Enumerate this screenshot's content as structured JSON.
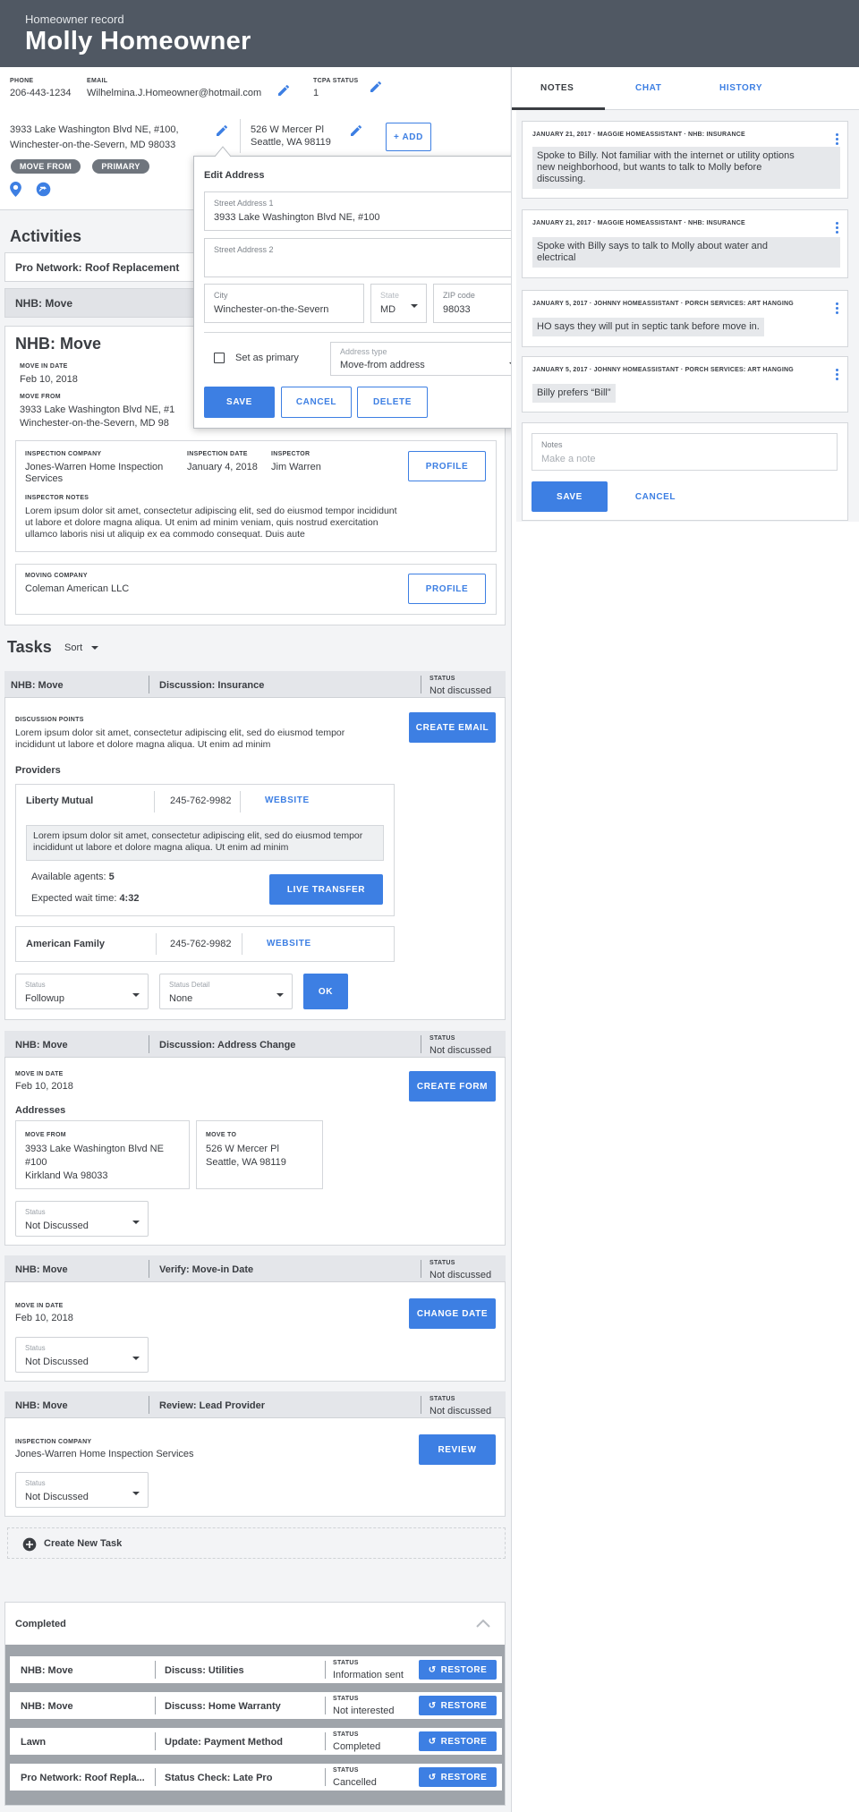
{
  "header": {
    "subtitle": "Homeowner record",
    "name": "Molly Homeowner"
  },
  "contact": {
    "phone_label": "PHONE",
    "phone": "206-443-1234",
    "email_label": "EMAIL",
    "email": "Wilhelmina.J.Homeowner@hotmail.com",
    "tcpa_label": "TCPA STATUS",
    "tcpa": "1"
  },
  "addresses": {
    "from_line1": "3933 Lake Washington Blvd NE, #100,",
    "from_line2": "Winchester-on-the-Severn, MD 98033",
    "to_line1": "526 W Mercer Pl",
    "to_line2": "Seattle, WA 98119",
    "add_label": "+ ADD",
    "badge_move_from": "MOVE FROM",
    "badge_primary": "PRIMARY"
  },
  "activities": {
    "heading": "Activities",
    "item1": "Pro Network: Roof Replacement",
    "item2": "NHB: Move",
    "detail_title": "NHB: Move",
    "move_in_label": "MOVE IN DATE",
    "move_in": "Feb 10, 2018",
    "move_from_label": "MOVE FROM",
    "move_from_1": "3933 Lake Washington Blvd NE, #1",
    "move_from_2": "Winchester-on-the-Severn, MD 98",
    "insp_company_label": "INSPECTION COMPANY",
    "insp_company": "Jones-Warren Home Inspection Services",
    "insp_date_label": "INSPECTION DATE",
    "insp_date": "January 4, 2018",
    "inspector_label": "INSPECTOR",
    "inspector": "Jim Warren",
    "profile": "PROFILE",
    "insp_notes_label": "INSPECTOR NOTES",
    "insp_notes": "Lorem ipsum dolor sit amet, consectetur adipiscing elit, sed do eiusmod tempor incididunt ut labore et dolore magna aliqua. Ut enim ad minim veniam, quis nostrud exercitation ullamco laboris nisi ut aliquip ex ea commodo consequat. Duis aute",
    "moving_company_label": "MOVING COMPANY",
    "moving_company": "Coleman American LLC"
  },
  "edit_address": {
    "title": "Edit Address",
    "street1_label": "Street Address 1",
    "street1": "3933 Lake Washington Blvd NE, #100",
    "street2_label": "Street Address 2",
    "city_label": "City",
    "city": "Winchester-on-the-Severn",
    "state_label": "State",
    "state": "MD",
    "zip_label": "ZIP code",
    "zip": "98033",
    "primary_label": "Set as primary",
    "type_label": "Address type",
    "type": "Move-from address",
    "save": "SAVE",
    "cancel": "CANCEL",
    "delete": "DELETE"
  },
  "tasks": {
    "heading": "Tasks",
    "sort": "Sort",
    "status_label": "STATUS",
    "t1": {
      "cat": "NHB: Move",
      "name": "Discussion: Insurance",
      "status": "Not discussed",
      "dp_label": "DISCUSSION POINTS",
      "dp": "Lorem ipsum dolor sit amet, consectetur adipiscing elit, sed do eiusmod tempor incididunt ut labore et dolore magna aliqua. Ut enim ad minim",
      "button": "CREATE EMAIL",
      "providers_label": "Providers",
      "p1_name": "Liberty Mutual",
      "p1_phone": "245-762-9982",
      "p1_web": "WEBSITE",
      "p1_text": "Lorem ipsum dolor sit amet, consectetur adipiscing elit, sed do eiusmod tempor incididunt ut labore et dolore magna aliqua. Ut enim ad minim",
      "agents_label": "Available agents:",
      "agents": "5",
      "wait_label": "Expected wait time:",
      "wait": "4:32",
      "live_transfer": "LIVE TRANSFER",
      "p2_name": "American Family",
      "p2_phone": "245-762-9982",
      "p2_web": "WEBSITE",
      "status_ph": "Status",
      "status_val": "Followup",
      "detail_ph": "Status Detail",
      "detail_val": "None",
      "ok": "OK"
    },
    "t2": {
      "cat": "NHB: Move",
      "name": "Discussion: Address Change",
      "status": "Not discussed",
      "move_in_label": "MOVE IN DATE",
      "move_in": "Feb 10, 2018",
      "button": "CREATE FORM",
      "addresses_label": "Addresses",
      "from_label": "MOVE FROM",
      "from1": "3933 Lake Washington Blvd NE",
      "from2": "#100",
      "from3": "Kirkland Wa 98033",
      "to_label": "MOVE TO",
      "to1": "526 W Mercer Pl",
      "to2": "Seattle, WA 98119",
      "status_ph": "Status",
      "status_val": "Not Discussed"
    },
    "t3": {
      "cat": "NHB: Move",
      "name": "Verify: Move-in Date",
      "status": "Not discussed",
      "move_in_label": "MOVE IN DATE",
      "move_in": "Feb 10, 2018",
      "button": "CHANGE DATE",
      "status_ph": "Status",
      "status_val": "Not Discussed"
    },
    "t4": {
      "cat": "NHB: Move",
      "name": "Review: Lead Provider",
      "status": "Not discussed",
      "company_label": "INSPECTION COMPANY",
      "company": "Jones-Warren Home Inspection Services",
      "button": "REVIEW",
      "status_ph": "Status",
      "status_val": "Not Discussed"
    },
    "create_new": "Create New Task"
  },
  "completed": {
    "heading": "Completed",
    "restore": "RESTORE",
    "rows": [
      {
        "cat": "NHB: Move",
        "name": "Discuss: Utilities",
        "status": "Information sent"
      },
      {
        "cat": "NHB: Move",
        "name": "Discuss: Home Warranty",
        "status": "Not interested"
      },
      {
        "cat": "Lawn",
        "name": "Update: Payment Method",
        "status": "Completed"
      },
      {
        "cat": "Pro Network: Roof Repla...",
        "name": "Status Check: Late Pro",
        "status": "Cancelled"
      }
    ]
  },
  "notes_panel": {
    "tabs": [
      "NOTES",
      "CHAT",
      "HISTORY"
    ],
    "notes": [
      {
        "date": "JANUARY 21, 2017",
        "author": "MAGGIE HOMEASSISTANT",
        "topic": "NHB: INSURANCE",
        "l1": "Spoke to Billy.  Not familiar with the internet or utility options",
        "l2": "new neighborhood, but wants to talk to Molly before",
        "l3": "discussing."
      },
      {
        "date": "JANUARY 21, 2017",
        "author": "MAGGIE HOMEASSISTANT",
        "topic": "NHB: INSURANCE",
        "l1": "Spoke with Billy says to talk to Molly about water and",
        "l2": "electrical"
      },
      {
        "date": "JANUARY 5, 2017",
        "author": "JOHNNY HOMEASSISTANT",
        "topic": "PORCH SERVICES: ART HANGING",
        "l1": "HO says they will put in septic tank before move in."
      },
      {
        "date": "JANUARY 5, 2017",
        "author": "JOHNNY HOMEASSISTANT",
        "topic": "PORCH SERVICES: ART HANGING",
        "l1": "Billy prefers “Bill”"
      }
    ],
    "compose_label": "Notes",
    "compose_placeholder": "Make a note",
    "save": "SAVE",
    "cancel": "CANCEL"
  },
  "colors": {
    "accent": "#3d7fe3",
    "header": "#505863",
    "badge": "#6f757d"
  }
}
